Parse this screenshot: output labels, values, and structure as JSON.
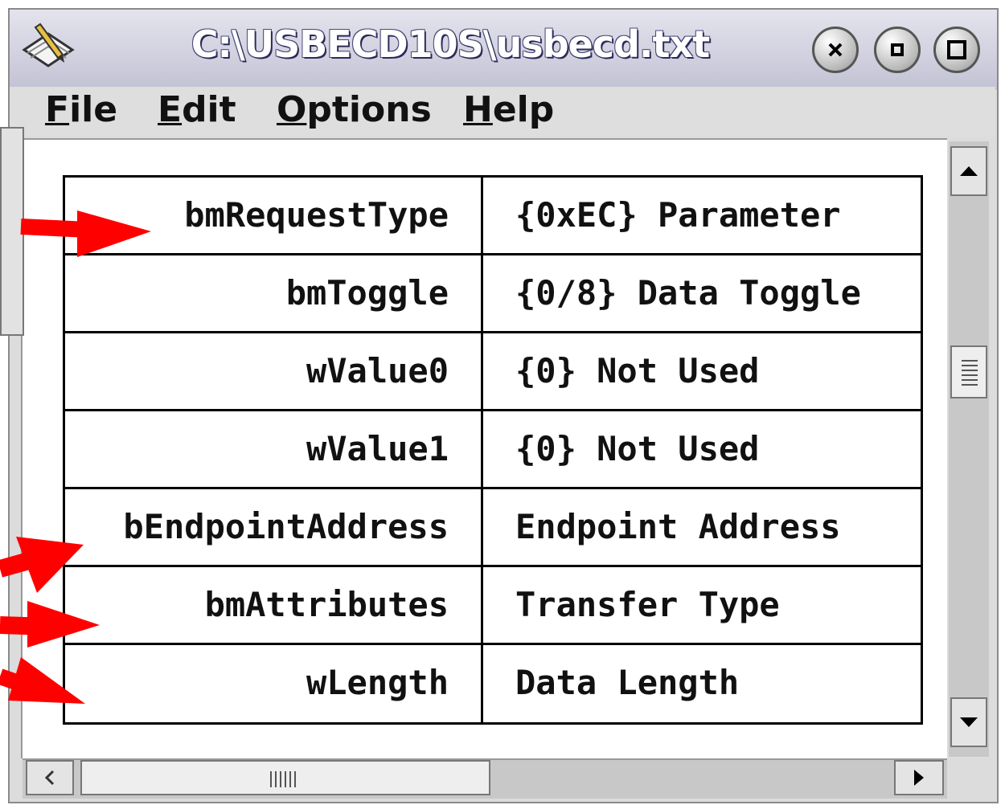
{
  "window": {
    "title": "C:\\USBECD10S\\usbecd.txt"
  },
  "menu": {
    "items": [
      {
        "label": "File",
        "mnemonic": "F",
        "rest": "ile"
      },
      {
        "label": "Edit",
        "mnemonic": "E",
        "rest": "dit"
      },
      {
        "label": "Options",
        "mnemonic": "O",
        "rest": "ptions"
      },
      {
        "label": "Help",
        "mnemonic": "H",
        "rest": "elp"
      }
    ]
  },
  "table": {
    "rows": [
      {
        "field": "bmRequestType",
        "description": "{0xEC} Parameter"
      },
      {
        "field": "bmToggle",
        "description": "{0/8} Data Toggle"
      },
      {
        "field": "wValue0",
        "description": "{0} Not Used"
      },
      {
        "field": "wValue1",
        "description": "{0} Not Used"
      },
      {
        "field": "bEndpointAddress",
        "description": "Endpoint Address"
      },
      {
        "field": "bmAttributes",
        "description": "Transfer Type"
      },
      {
        "field": "wLength",
        "description": "Data Length"
      }
    ]
  },
  "icons": {
    "app": "notepad-pen-icon",
    "close": "close-icon",
    "minimize": "minimize-icon",
    "maximize": "maximize-icon",
    "scroll_up": "scroll-up-arrow-icon",
    "scroll_down": "scroll-down-arrow-icon",
    "scroll_left": "scroll-left-arrow-icon",
    "scroll_right": "scroll-right-arrow-icon",
    "annotation": "red-arrow-icon"
  },
  "colors": {
    "annotation": "#ff0000",
    "title_bar": "#c8c8d8",
    "chrome": "#dcdcdc"
  }
}
